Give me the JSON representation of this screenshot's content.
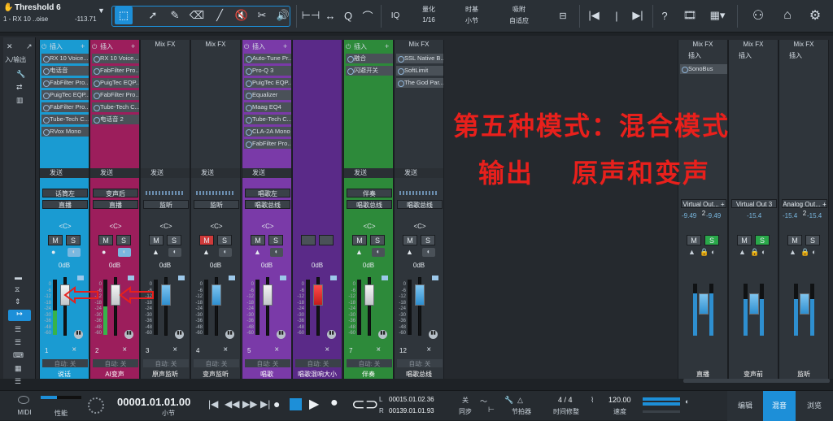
{
  "colors": {
    "accent": "#1d8fd8",
    "play": "#1d8fd8",
    "mute_red": "#d03a3a",
    "solo_green": "#2aa84a",
    "overlay_red": "#e8201c",
    "ch1": "#1a9bd2",
    "ch2": "#9c1e5c",
    "ch5": "#7a3aa8",
    "ch6": "#5a2a88",
    "ch7": "#2d8a3a"
  },
  "titlebar": {
    "song": "Threshold 6",
    "track": "1 - RX 10 ..oise",
    "level": "-113.71"
  },
  "toolbar": {
    "quantize_label": "量化",
    "quantize_value": "1/16",
    "timebase_label": "时基",
    "timebase_value": "小节",
    "snap_label": "吸附",
    "snap_value": "自适应",
    "iq": "IQ",
    "help": "?"
  },
  "overlay": {
    "line1": "第五种模式：混合模式",
    "line2a": "输出",
    "line2b": "原声和变声"
  },
  "left_panel": {
    "input": "入/输出"
  },
  "channels": [
    {
      "id": "1",
      "header": "插入",
      "slots": [
        "RX 10 Voice...",
        "电话音",
        "FabFilter Pro...",
        "PuigTec EQP...",
        "FabFilter Pro...",
        "Tube-Tech C...",
        "RVox Mono"
      ],
      "send": "发送",
      "route1": "话筒左",
      "route2": "直播",
      "pan": "<C>",
      "db": "0dB",
      "number": "1",
      "auto": "自动: 关",
      "name": "说话",
      "color": "#1a9bd2"
    },
    {
      "id": "2",
      "header": "插入",
      "slots": [
        "RX 10 Voice...",
        "FabFilter Pro...",
        "PuigTec EQP...",
        "FabFilter Pro...",
        "Tube-Tech C...",
        "电话音 2"
      ],
      "send": "发送",
      "route1": "变声后",
      "route2": "直播",
      "pan": "<C>",
      "db": "0dB",
      "number": "2",
      "auto": "自动: 关",
      "name": "AI变声",
      "color": "#9c1e5c"
    },
    {
      "id": "3",
      "header": "Mix FX",
      "slots": [],
      "send": "发送",
      "route1": "",
      "route2": "监听",
      "pan": "<C>",
      "db": "0dB",
      "number": "3",
      "auto": "自动: 关",
      "name": "原声监听",
      "color": "#2f353b"
    },
    {
      "id": "4",
      "header": "Mix FX",
      "slots": [],
      "send": "发送",
      "route1": "",
      "route2": "监听",
      "pan": "<C>",
      "db": "0dB",
      "number": "4",
      "auto": "自动: 关",
      "name": "变声监听",
      "color": "#2f353b"
    },
    {
      "id": "5",
      "header": "插入",
      "slots": [
        "Auto-Tune Pr...",
        "Pro-Q 3",
        "PuigTec EQP...",
        "Equalizer",
        "Maag EQ4",
        "Tube-Tech C...",
        "CLA-2A Mono",
        "FabFilter Pro..."
      ],
      "send": "发送",
      "route1": "唱歌左",
      "route2": "唱歌总线",
      "pan": "<C>",
      "db": "0dB",
      "number": "5",
      "auto": "自动: 关",
      "name": "唱歌",
      "color": "#7a3aa8"
    },
    {
      "id": "6",
      "header": "",
      "slots": [],
      "send": "",
      "route1": "",
      "route2": "",
      "pan": "",
      "db": "0dB",
      "number": "",
      "auto": "自动: 关",
      "name": "唱歌混响大小",
      "color": "#5a2a88"
    },
    {
      "id": "7",
      "header": "插入",
      "slots": [
        "融合",
        "闪避开关"
      ],
      "send": "发送",
      "route1": "伴奏",
      "route2": "唱歌总线",
      "pan": "<C>",
      "db": "0dB",
      "number": "7",
      "auto": "自动: 关",
      "name": "伴奏",
      "color": "#2d8a3a"
    },
    {
      "id": "12",
      "header": "Mix FX",
      "slots": [
        "SSL Native B...",
        "SoftLimit",
        "The God Par..."
      ],
      "send": "发送",
      "route1": "",
      "route2": "唱歌总线",
      "pan": "<C>",
      "db": "0dB",
      "number": "12",
      "auto": "自动: 关",
      "name": "唱歌总线",
      "color": "#2f353b"
    }
  ],
  "outputs": [
    {
      "header": "Mix FX",
      "ins": "插入",
      "slot": "SonoBus",
      "route": "Virtual Out... + 2",
      "val1": "-9.49",
      "val2": "-9.49",
      "name": "直播"
    },
    {
      "header": "Mix FX",
      "ins": "插入",
      "slot": "",
      "route": "Virtual Out 3",
      "val1": "-15.4",
      "val2": "",
      "name": "变声前"
    },
    {
      "header": "Mix FX",
      "ins": "插入",
      "slot": "",
      "route": "Analog Out... + 2",
      "val1": "-15.4",
      "val2": "-15.4",
      "name": "监听"
    }
  ],
  "fader_scale": [
    "0",
    "-6",
    "-12",
    "-18",
    "-24",
    "-30",
    "-36",
    "-48",
    "-60"
  ],
  "transport": {
    "midi": "MIDI",
    "performance": "性能",
    "time": "00001.01.01.00",
    "time_unit": "小节",
    "l_pos": "00015.01.02.36",
    "r_pos": "00139.01.01.93",
    "sync_label": "同步",
    "sync_value": "关",
    "metronome": "节拍器",
    "timesig_label": "时间修整",
    "timesig": "4 / 4",
    "tempo": "120.00",
    "tempo_label": "速度",
    "edit": "编辑",
    "mix": "混音",
    "browse": "浏览"
  }
}
